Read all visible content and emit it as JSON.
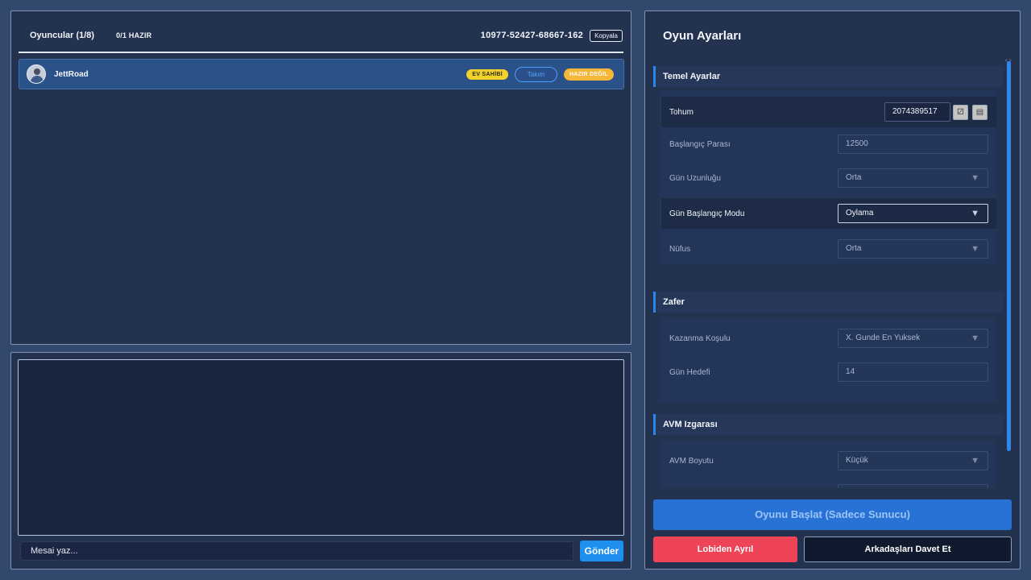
{
  "players": {
    "title": "Oyuncular (1/8)",
    "ready_count": "0/1 HAZIR",
    "lobby_code": "10977-52427-68667-162",
    "copy_label": "Kopyala",
    "list": [
      {
        "name": "JettRoad",
        "host_badge": "EV SAHİBİ",
        "team_label": "Takım",
        "status": "HAZIR DEĞİL"
      }
    ]
  },
  "chat": {
    "placeholder": "Mesai yaz...",
    "send_label": "Gönder"
  },
  "settings": {
    "title": "Oyun Ayarları",
    "sections": {
      "basic": {
        "title": "Temel Ayarlar",
        "seed_label": "Tohum",
        "seed_value": "2074389517",
        "seed_random_icon": "dice-icon",
        "seed_copy_icon": "clipboard-icon",
        "start_money_label": "Başlangıç Parası",
        "start_money_value": "12500",
        "day_length_label": "Gün Uzunluğu",
        "day_length_value": "Orta",
        "day_start_mode_label": "Gün Başlangıç Modu",
        "day_start_mode_value": "Oylama",
        "population_label": "Nüfus",
        "population_value": "Orta"
      },
      "victory": {
        "title": "Zafer",
        "win_condition_label": "Kazanma Koşulu",
        "win_condition_value": "X. Gunde En Yuksek",
        "day_goal_label": "Gün Hedefi",
        "day_goal_value": "14"
      },
      "mall_grid": {
        "title": "AVM Izgarası",
        "mall_size_label": "AVM Boyutu",
        "mall_size_value": "Küçük"
      }
    },
    "start_label": "Oyunu Başlat (Sadece Sunucu)",
    "leave_label": "Lobiden Ayrıl",
    "invite_label": "Arkadaşları Davet Et"
  },
  "colors": {
    "background": "#33486d",
    "panel": "#22324f",
    "accent": "#2f86ee",
    "host_badge": "#f2d22a",
    "not_ready": "#f6b63a",
    "leave": "#ef4358"
  }
}
